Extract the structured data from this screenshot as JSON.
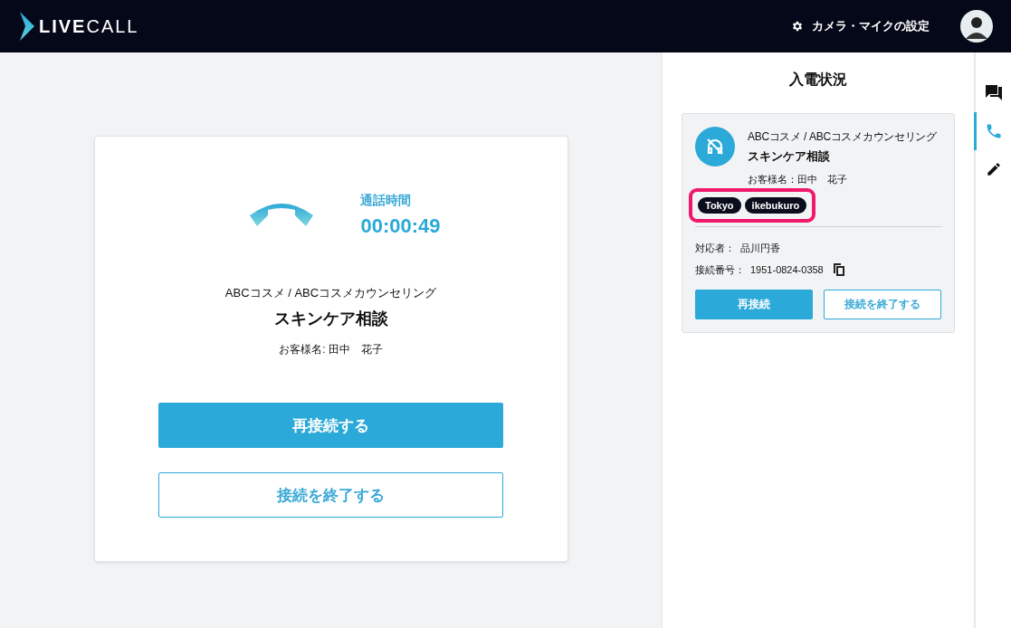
{
  "header": {
    "logo_bold": "LIVE",
    "logo_light": "CALL",
    "settings_label": "カメラ・マイクの設定"
  },
  "call_panel": {
    "duration_label": "通話時間",
    "duration": "00:00:49",
    "company": "ABCコスメ / ABCコスメカウンセリング",
    "topic": "スキンケア相談",
    "customer": "お客様名: 田中　花子",
    "buttons": [
      {
        "label": "再接続する",
        "kind": "primary"
      },
      {
        "label": "接続を終了する",
        "kind": "outline"
      }
    ]
  },
  "incoming": {
    "title": "入電状況",
    "card": {
      "company": "ABCコスメ / ABCコスメカウンセリング",
      "topic": "スキンケア相談",
      "customer": "お客様名：田中　花子",
      "tags": [
        "Tokyo",
        "ikebukuro"
      ],
      "tags_highlighted": true,
      "agent_label": "対応者：",
      "agent": "品川円香",
      "number_label": "接続番号：",
      "number": "1951-0824-0358",
      "buttons": [
        {
          "label": "再接続",
          "kind": "primary"
        },
        {
          "label": "接続を終了する",
          "kind": "outline"
        }
      ]
    }
  },
  "side_tabs": [
    {
      "kind": "chat",
      "selected": false
    },
    {
      "kind": "phone",
      "selected": true
    },
    {
      "kind": "edit",
      "selected": false
    }
  ]
}
